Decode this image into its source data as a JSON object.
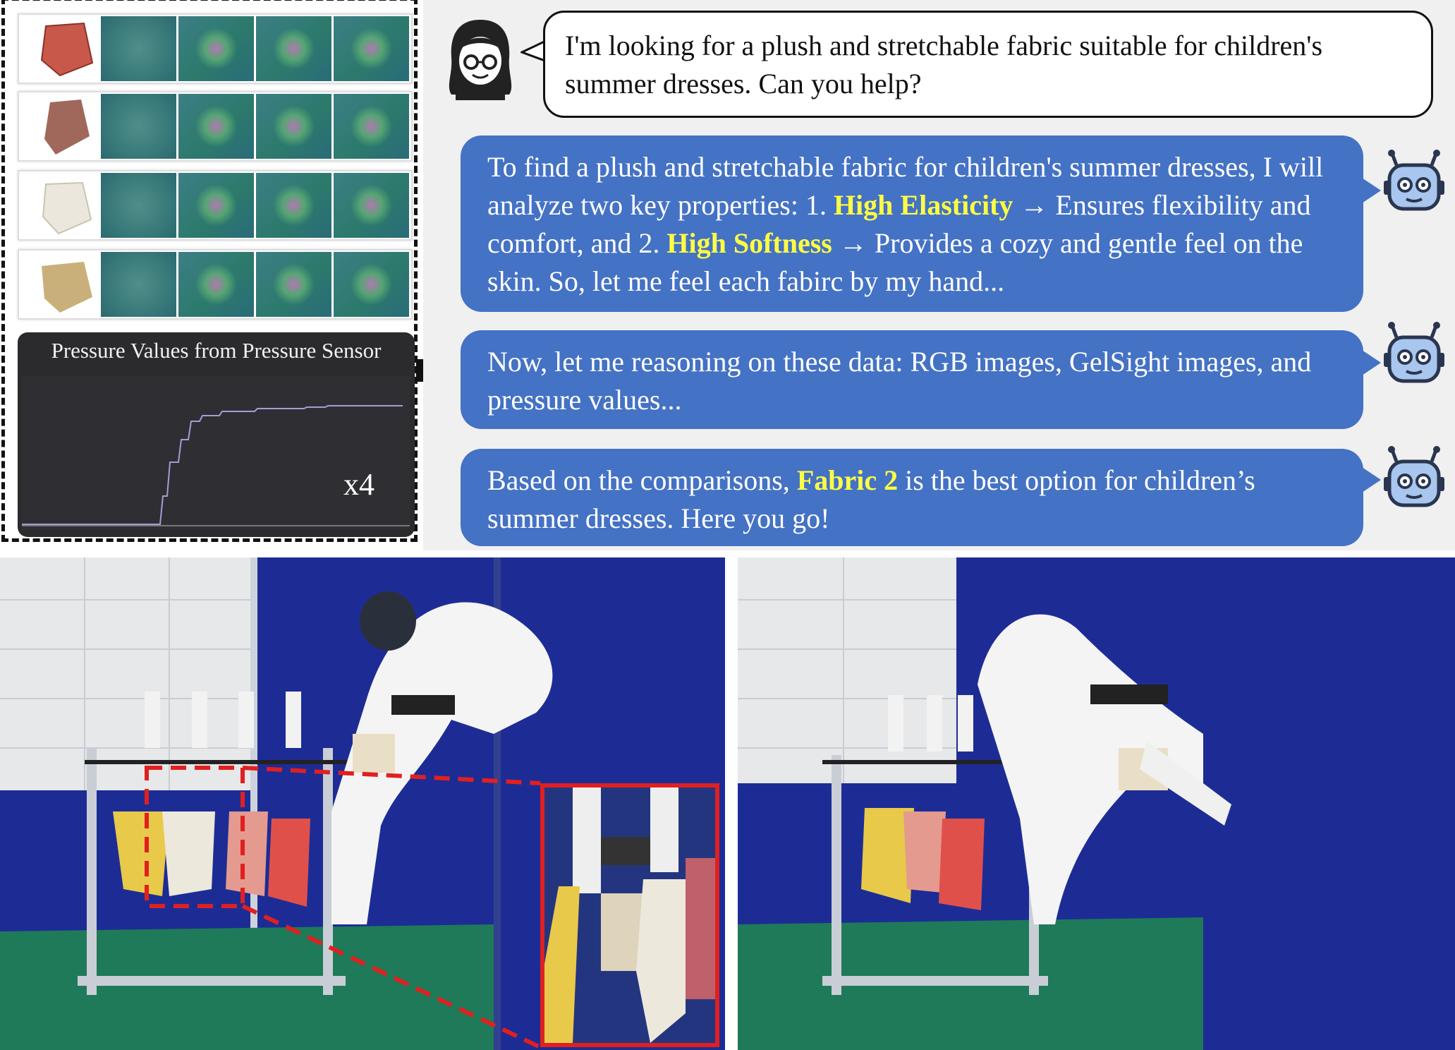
{
  "left_panel": {
    "rows": [
      {
        "fabric_color": "#c8584a"
      },
      {
        "fabric_color": "#a0685a"
      },
      {
        "fabric_color": "#e8e4d8"
      },
      {
        "fabric_color": "#c9b07a"
      }
    ],
    "pressure_card": {
      "title": "Pressure Values from Pressure Sensor",
      "multiplier": "x4",
      "line_color": "#a49bd8"
    }
  },
  "chat": {
    "user_message": "I'm looking for a plush and stretchable fabric suitable for children's summer dresses. Can you help?",
    "bot_1": {
      "part1": "To find a plush and stretchable fabric for children's summer dresses, I will analyze two key properties: 1. ",
      "highlight1": "High Elasticity",
      "part2": " → Ensures flexibility and comfort, and 2. ",
      "highlight2": "High Softness",
      "part3": " → Provides a cozy and gentle feel on the skin. So, let me feel each fabirc by my hand..."
    },
    "bot_2": {
      "text": "Now, let me reasoning on these data: RGB images, GelSight images, and pressure values..."
    },
    "bot_3": {
      "part1": "Based on the comparisons, ",
      "highlight": "Fabric 2",
      "part2": " is the best option for children’s summer dresses.  Here you go!"
    }
  },
  "colors": {
    "bot_bubble": "#4472c4",
    "highlight": "#ffff44",
    "inset_border": "#e02020"
  }
}
